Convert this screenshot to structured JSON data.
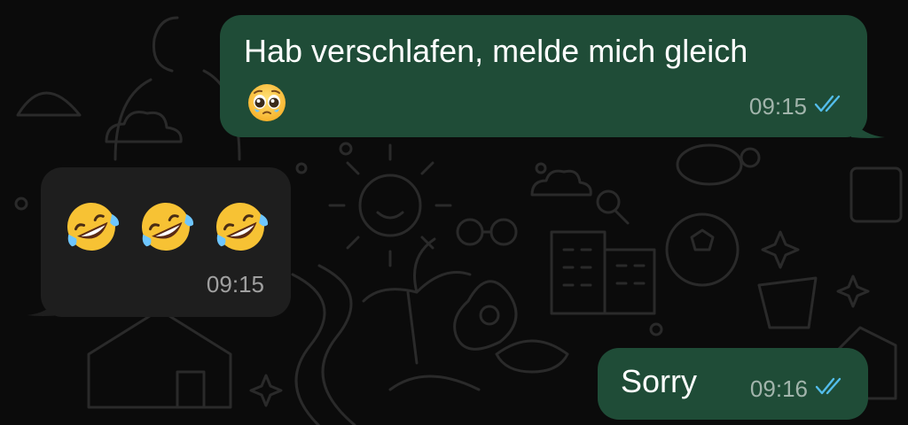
{
  "chat": {
    "messages": [
      {
        "direction": "outgoing",
        "text": "Hab verschlafen, melde mich gleich",
        "emoji": "pleading-face-with-tears",
        "time": "09:15",
        "status": "read"
      },
      {
        "direction": "incoming",
        "emojis": [
          "rolling-on-floor-laughing",
          "rolling-on-floor-laughing",
          "rolling-on-floor-laughing"
        ],
        "time": "09:15"
      },
      {
        "direction": "outgoing",
        "text": "Sorry",
        "time": "09:16",
        "status": "read"
      }
    ]
  },
  "colors": {
    "background": "#0b0b0b",
    "outgoing_bubble": "#1f4c37",
    "incoming_bubble": "#1e1e1e",
    "read_ticks": "#53bdeb"
  }
}
